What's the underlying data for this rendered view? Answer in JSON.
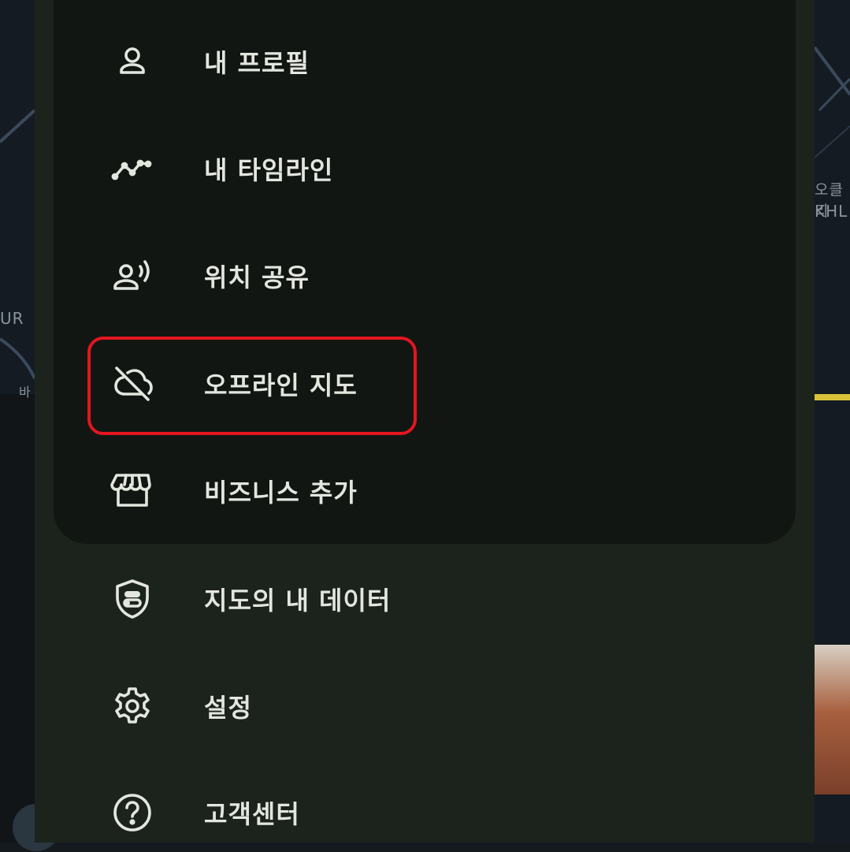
{
  "menu": {
    "items": [
      {
        "label": "내 프로필",
        "icon": "person-icon"
      },
      {
        "label": "내 타임라인",
        "icon": "timeline-icon"
      },
      {
        "label": "위치 공유",
        "icon": "location-sharing-icon"
      },
      {
        "label": "오프라인 지도",
        "icon": "cloud-off-icon",
        "highlighted": true
      },
      {
        "label": "비즈니스 추가",
        "icon": "storefront-icon"
      },
      {
        "label": "지도의 내 데이터",
        "icon": "shield-toggle-icon"
      },
      {
        "label": "설정",
        "icon": "gear-icon"
      },
      {
        "label": "고객센터",
        "icon": "help-icon"
      }
    ]
  },
  "background": {
    "labels": [
      "UR",
      "바",
      "오클리",
      "KHL"
    ]
  },
  "colors": {
    "panel_top": "#121612",
    "panel_bottom": "#1c231c",
    "text": "#e3e6df",
    "highlight": "#e3161f"
  }
}
